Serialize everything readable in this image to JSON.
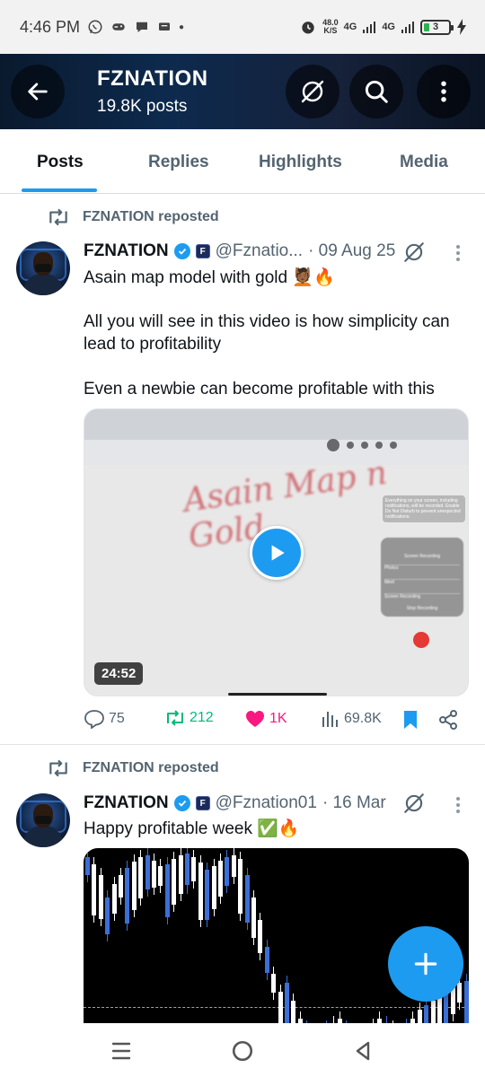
{
  "status_bar": {
    "time": "4:46 PM",
    "net_speed_value": "48.0",
    "net_speed_unit": "K/S",
    "network_1": "4G",
    "network_2": "4G",
    "battery": "3"
  },
  "header": {
    "title": "FZNATION",
    "subtitle": "19.8K posts"
  },
  "tabs": [
    {
      "label": "Posts",
      "active": true
    },
    {
      "label": "Replies",
      "active": false
    },
    {
      "label": "Highlights",
      "active": false
    },
    {
      "label": "Media",
      "active": false
    }
  ],
  "posts": [
    {
      "repost_label": "FZNATION reposted",
      "author_name": "FZNATION",
      "handle": "@Fznatio...",
      "date": "· 09 Aug 25",
      "text_lines": [
        "Asain map model with gold 💆🏾🔥",
        "All you will see in this video is how simplicity can lead to profitability",
        "Even a newbie can become profitable with this"
      ],
      "video": {
        "duration": "24:52",
        "handwriting": "Asain Map n Gold",
        "panel_title": "Screen Recording",
        "panel_items": [
          "Photos",
          "Meet",
          "Screen Recording"
        ],
        "panel_action": "Stop Recording",
        "note": "Everything on your screen, including notifications, will be recorded. Enable Do Not Disturb to prevent unexpected notifications."
      },
      "stats": {
        "replies": "75",
        "reposts": "212",
        "likes": "1K",
        "views": "69.8K"
      }
    },
    {
      "repost_label": "FZNATION reposted",
      "author_name": "FZNATION",
      "handle": "@Fznation01",
      "date": "· 16 Mar",
      "text_lines": [
        "Happy profitable week ✅🔥"
      ]
    }
  ],
  "icons": {
    "back": "arrow-left-icon",
    "grok": "grok-icon",
    "search": "search-icon",
    "more": "more-vertical-icon",
    "repost": "repost-icon",
    "verified": "verified-badge-icon",
    "reply": "reply-icon",
    "like": "heart-icon",
    "views": "views-icon",
    "bookmark": "bookmark-icon",
    "share": "share-icon",
    "compose": "plus-icon"
  },
  "colors": {
    "accent": "#1d9bf0",
    "repost_green": "#00ba7c",
    "like_pink": "#f91880",
    "muted_text": "#536471"
  }
}
